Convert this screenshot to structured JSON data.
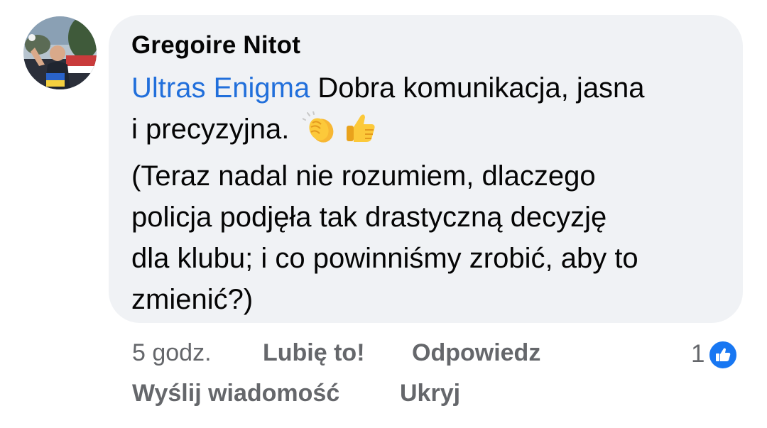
{
  "comment": {
    "author": "Gregoire Nitot",
    "mention": "Ultras Enigma",
    "line1_rest": " Dobra komunikacja, jasna",
    "line2": "i precyzyjna.",
    "line3": "(Teraz nadal nie rozumiem, dlaczego",
    "line4": "policja podjęła tak drastyczną decyzję",
    "line5": "dla klubu; i co powinniśmy zrobić, aby to",
    "line6": "zmienić?)",
    "emojis": [
      "clapping-hands-icon",
      "thumbs-up-icon"
    ]
  },
  "actions": {
    "time": "5 godz.",
    "like": "Lubię to!",
    "reply": "Odpowiedz",
    "message": "Wyślij wiadomość",
    "hide": "Ukryj"
  },
  "reactions": {
    "count": "1",
    "icon": "like-icon"
  },
  "colors": {
    "bubble": "#f0f2f5",
    "mention": "#216fdb",
    "muted": "#65676b",
    "like_blue": "#1877f2"
  }
}
